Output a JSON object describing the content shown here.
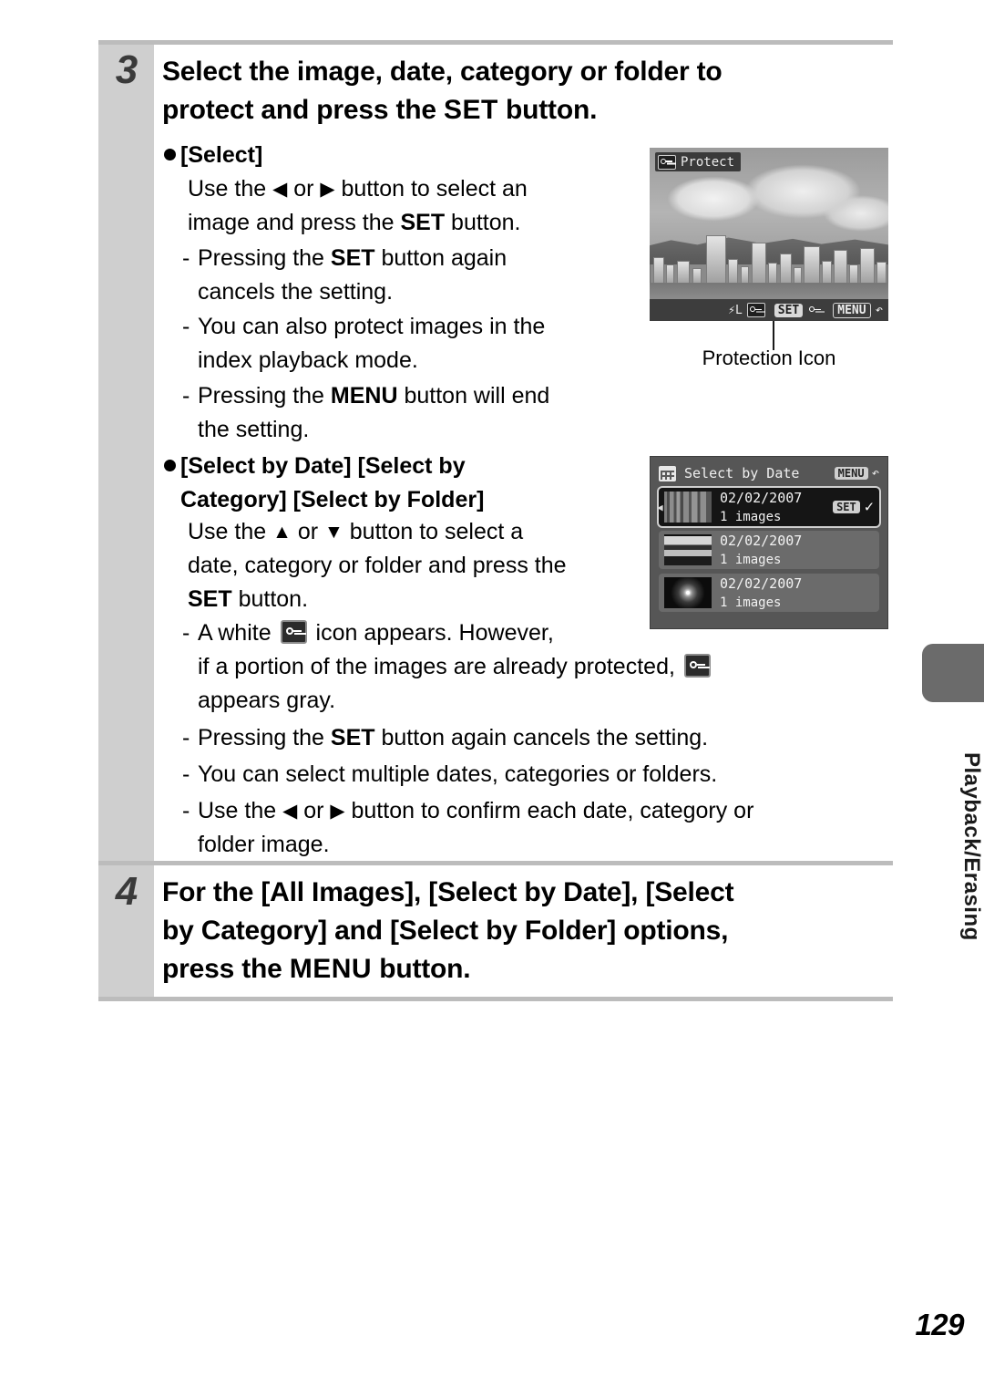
{
  "page": {
    "number": "129",
    "side_tab_label": "Playback/Erasing"
  },
  "steps": [
    {
      "number": "3",
      "title_line1": "Select the image, date, category or folder to",
      "title_line2_pre": "protect and press the ",
      "title_line2_kw": "SET",
      "title_line2_post": " button."
    },
    {
      "number": "4",
      "title_line1": "For the [All Images], [Select by Date], [Select",
      "title_line2": "by Category] and [Select by Folder] options,",
      "title_line3_pre": "press the ",
      "title_line3_kw": "MENU",
      "title_line3_post": " button."
    }
  ],
  "select_section": {
    "heading": "[Select]",
    "body_line1_a": "Use the ",
    "body_line1_left_arrow": "◀",
    "body_line1_b": " or ",
    "body_line1_right_arrow": "▶",
    "body_line1_c": " button to select an",
    "body_line2_a": "image and press the ",
    "body_line2_kw": "SET",
    "body_line2_b": " button.",
    "dashes": [
      {
        "a": "Pressing the ",
        "kw": "SET",
        "b": " button again",
        "cont": "cancels the setting."
      },
      {
        "a": "You can also protect images in the",
        "kw": "",
        "b": "",
        "cont": "index playback mode."
      },
      {
        "a": "Pressing the ",
        "kw": "MENU",
        "b": " button will end",
        "cont": "the setting."
      }
    ]
  },
  "select_by_section": {
    "heading_line1": "[Select by Date] [Select by",
    "heading_line2": "Category] [Select by Folder]",
    "body_line1_a": "Use the ",
    "body_line1_up_arrow": "▲",
    "body_line1_b": " or ",
    "body_line1_down_arrow": "▼",
    "body_line1_c": " button to select a",
    "body_line2": "date, category or folder and press the",
    "body_line3_kw": "SET",
    "body_line3_post": " button.",
    "dash_white_icon_a": "A white ",
    "dash_white_icon_b": " icon appears. However,",
    "dash_white_icon_c": "if a portion of the images are already protected, ",
    "dash_white_icon_d": "appears gray.",
    "dash2_a": "Pressing the ",
    "dash2_kw": "SET",
    "dash2_b": " button again cancels the setting.",
    "dash3": "You can select multiple dates, categories or folders.",
    "dash4_a": "Use the ",
    "dash4_left_arrow": "◀",
    "dash4_b": " or ",
    "dash4_right_arrow": "▶",
    "dash4_c": " button to confirm each date, category or",
    "dash4_cont": "folder image."
  },
  "screenshot_protect": {
    "badge_label": "Protect",
    "badge_icon": "key-icon",
    "bottom_bar": {
      "flash_label": "L",
      "protect_chip_icon": "key-icon",
      "set_chip": "SET",
      "protect_icon": "key-icon",
      "menu_chip": "MENU",
      "return_icon": "↶"
    },
    "caption": "Protection Icon"
  },
  "screenshot_select_by_date": {
    "title": "Select by Date",
    "title_icon": "calendar-icon",
    "menu_chip": "MENU",
    "return_icon": "↶",
    "rows": [
      {
        "date": "02/02/2007",
        "count": "1 images",
        "set_chip": "SET",
        "check": "✓",
        "selected": true,
        "thumb": "forest-thumbnail"
      },
      {
        "date": "02/02/2007",
        "count": "1 images",
        "set_chip": "",
        "check": "",
        "selected": false,
        "thumb": "city-thumbnail"
      },
      {
        "date": "02/02/2007",
        "count": "1 images",
        "set_chip": "",
        "check": "",
        "selected": false,
        "thumb": "fireworks-thumbnail"
      }
    ]
  },
  "colors": {
    "step_band": "#cfcfcf",
    "rule": "#bcbcbc",
    "tab": "#6b6b6b",
    "lcd_dark": "#3d3d3d"
  }
}
